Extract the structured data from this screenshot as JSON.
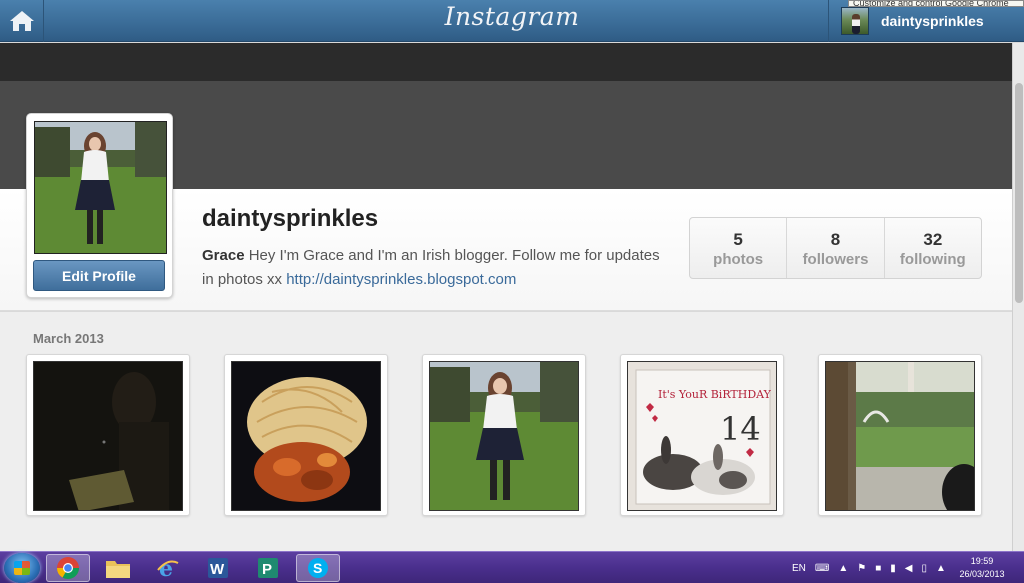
{
  "topbar": {
    "logo": "Instagram",
    "username": "daintysprinkles",
    "tooltip": "Customize and control Google Chrome"
  },
  "profile": {
    "username": "daintysprinkles",
    "bio_name": "Grace",
    "bio_text": "Hey I'm Grace and I'm an Irish blogger. Follow me for updates in photos xx",
    "bio_link": "http://daintysprinkles.blogspot.com",
    "edit_label": "Edit Profile"
  },
  "stats": [
    {
      "count": "5",
      "label": "photos"
    },
    {
      "count": "8",
      "label": "followers"
    },
    {
      "count": "32",
      "label": "following"
    }
  ],
  "photos": {
    "month": "March 2013",
    "items": [
      {
        "icon": "dark-photo"
      },
      {
        "icon": "food-photo"
      },
      {
        "icon": "portrait-photo"
      },
      {
        "icon": "birthday-card-photo",
        "card_text": "It's YouR BiRTHDAY",
        "card_number": "14"
      },
      {
        "icon": "garden-window-photo"
      }
    ]
  },
  "taskbar": {
    "apps": [
      "Chrome",
      "File Explorer",
      "Internet Explorer",
      "Word",
      "Publisher",
      "Skype"
    ],
    "language": "EN",
    "time": "19:59",
    "date": "26/03/2013"
  }
}
